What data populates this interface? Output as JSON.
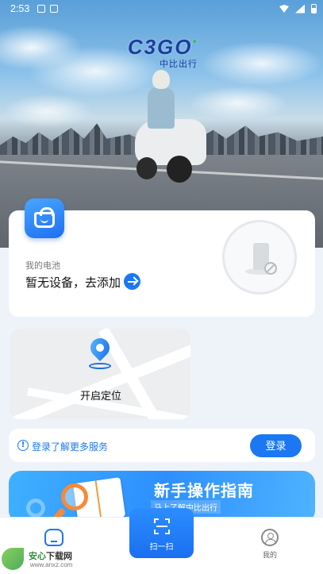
{
  "status_bar": {
    "time": "2:53"
  },
  "brand": {
    "logo_text": "C3GO",
    "logo_mark": "*",
    "logo_subtitle": "中比出行"
  },
  "battery_card": {
    "label": "我的电池",
    "empty_text": "暂无设备，去添加",
    "icon": "shopping-bag-icon"
  },
  "map_card": {
    "label": "开启定位",
    "icon": "location-pin-icon"
  },
  "login_bar": {
    "hint": "登录了解更多服务",
    "button": "登录"
  },
  "guide_banner": {
    "title": "新手操作指南",
    "subtitle": "马上了解中比出行"
  },
  "tab_bar": {
    "home_icon": "home-icon",
    "scan_label": "扫一扫",
    "mine_label": "我的"
  },
  "watermark": {
    "brand_a": "安心",
    "brand_b": "下载网",
    "url": "www.anxz.com"
  },
  "colors": {
    "accent": "#1b78f2",
    "background": "#eef3fa"
  }
}
